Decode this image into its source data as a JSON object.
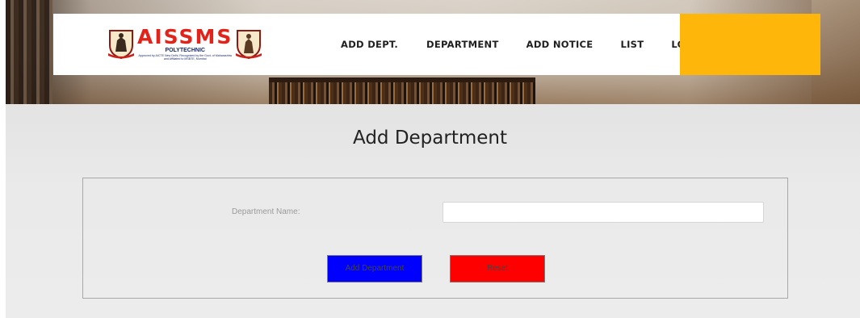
{
  "brand": {
    "name": "AISSMS",
    "subtitle": "POLYTECHNIC",
    "tagline": "Approved by AICTE New Delhi, Recognized by the Govt. of Maharashtra and Affiliated to MSBTE, Mumbai",
    "accent_color": "#ffb60a",
    "title_color": "#e2231a"
  },
  "nav": {
    "items": [
      {
        "label": "ADD DEPT."
      },
      {
        "label": "DEPARTMENT"
      },
      {
        "label": "ADD NOTICE"
      },
      {
        "label": "LIST"
      },
      {
        "label": "LOGOUT"
      }
    ]
  },
  "main": {
    "title": "Add Department",
    "form": {
      "department_name_label": "Department Name:",
      "department_name_value": "",
      "department_name_placeholder": "",
      "submit_label": "Add Department",
      "submit_color": "#0000ff",
      "reset_label": "Reset",
      "reset_color": "#ff0000"
    }
  }
}
